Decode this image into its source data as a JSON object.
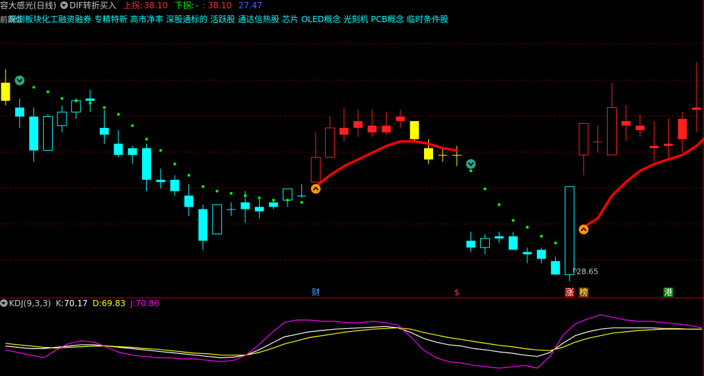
{
  "header": {
    "stock_name": "容大感光(日线)",
    "indicator": "DIF转折买入",
    "up_label": "上拐:",
    "up_value": "38.10",
    "down_label": "下拐:",
    "down_dash": "-",
    "down_value": ": 38.10",
    "extra_value": "27.47"
  },
  "concepts": "深圳板块化工融资融券 专精特新 高市净率 深股通标的 活跃股 通达信热股 芯片 OLED概念 光刻机 PCB概念 临时条件股",
  "overlap_text": "前期低",
  "kdj_header": {
    "name": "KDJ(9,3,3)",
    "k_label": "K:",
    "k_value": "70.17",
    "d_label": "D:",
    "d_value": "69.83",
    "j_label": "J:",
    "j_value": "70.86"
  },
  "markers": [
    {
      "text": "财",
      "color": "#4da6ff",
      "bar": 22
    },
    {
      "text": "$",
      "color": "#ff3333",
      "bar": 32
    },
    {
      "text": "涨",
      "color": "#ffffff",
      "bg": "#aa0000",
      "bar": 40
    },
    {
      "text": "榜",
      "color": "#ffff66",
      "bg": "#7a3a00",
      "bar": 41
    },
    {
      "text": "港",
      "color": "#ffffff",
      "bg": "#0a7a00",
      "bar": 47
    }
  ],
  "low_label": "28.65",
  "colors": {
    "up": "#ff2020",
    "down": "#00ffff",
    "special": "#ffff00",
    "sar": "#00ff00",
    "dif": "#ff0000",
    "k": "#ffffff",
    "d": "#ffff00",
    "j": "#ff00ff",
    "grid": "#800000"
  },
  "chart_data": [
    {
      "type": "candlestick",
      "title": "容大感光(日线)",
      "ylim": [
        27.5,
        39.5
      ],
      "candles": [
        {
          "o": 37.0,
          "h": 37.6,
          "l": 36.0,
          "c": 36.2,
          "color": "yellow"
        },
        {
          "o": 35.9,
          "h": 36.3,
          "l": 35.0,
          "c": 35.5,
          "color": "cyan"
        },
        {
          "o": 35.5,
          "h": 35.9,
          "l": 33.5,
          "c": 34.0,
          "color": "cyan"
        },
        {
          "o": 34.0,
          "h": 35.6,
          "l": 34.0,
          "c": 35.5,
          "color": "cyan"
        },
        {
          "o": 35.1,
          "h": 36.0,
          "l": 34.8,
          "c": 35.7,
          "color": "cyan"
        },
        {
          "o": 35.7,
          "h": 36.3,
          "l": 35.4,
          "c": 36.2,
          "color": "cyan"
        },
        {
          "o": 36.3,
          "h": 36.7,
          "l": 35.7,
          "c": 36.2,
          "color": "cyan"
        },
        {
          "o": 35.0,
          "h": 35.8,
          "l": 34.3,
          "c": 34.7,
          "color": "cyan"
        },
        {
          "o": 34.3,
          "h": 34.9,
          "l": 33.7,
          "c": 33.8,
          "color": "cyan"
        },
        {
          "o": 34.1,
          "h": 34.2,
          "l": 33.4,
          "c": 33.8,
          "color": "cyan"
        },
        {
          "o": 34.1,
          "h": 34.3,
          "l": 32.2,
          "c": 32.7,
          "color": "cyan"
        },
        {
          "o": 32.7,
          "h": 33.2,
          "l": 32.3,
          "c": 32.6,
          "color": "cyan"
        },
        {
          "o": 32.7,
          "h": 32.9,
          "l": 32.0,
          "c": 32.2,
          "color": "cyan"
        },
        {
          "o": 32.0,
          "h": 32.5,
          "l": 31.1,
          "c": 31.5,
          "color": "cyan"
        },
        {
          "o": 31.4,
          "h": 31.6,
          "l": 29.6,
          "c": 30.0,
          "color": "cyan"
        },
        {
          "o": 30.3,
          "h": 31.6,
          "l": 30.3,
          "c": 31.6,
          "color": "cyan"
        },
        {
          "o": 31.4,
          "h": 31.7,
          "l": 31.1,
          "c": 31.4,
          "color": "cyan"
        },
        {
          "o": 31.4,
          "h": 32.2,
          "l": 30.8,
          "c": 31.7,
          "color": "cyan"
        },
        {
          "o": 31.3,
          "h": 31.9,
          "l": 31.0,
          "c": 31.5,
          "color": "cyan"
        },
        {
          "o": 31.5,
          "h": 31.8,
          "l": 31.4,
          "c": 31.7,
          "color": "cyan"
        },
        {
          "o": 31.8,
          "h": 32.2,
          "l": 31.5,
          "c": 32.3,
          "color": "cyan"
        },
        {
          "o": 32.0,
          "h": 32.5,
          "l": 31.9,
          "c": 32.0,
          "color": "cyan"
        },
        {
          "o": 32.6,
          "h": 34.8,
          "l": 32.6,
          "c": 33.7,
          "color": "red"
        },
        {
          "o": 33.7,
          "h": 35.5,
          "l": 33.7,
          "c": 35.0,
          "color": "red"
        },
        {
          "o": 34.7,
          "h": 35.9,
          "l": 34.4,
          "c": 35.0,
          "color": "red"
        },
        {
          "o": 35.0,
          "h": 35.8,
          "l": 34.6,
          "c": 35.3,
          "color": "red"
        },
        {
          "o": 35.1,
          "h": 35.8,
          "l": 34.6,
          "c": 34.8,
          "color": "red"
        },
        {
          "o": 34.8,
          "h": 35.7,
          "l": 34.7,
          "c": 35.1,
          "color": "red"
        },
        {
          "o": 35.3,
          "h": 35.8,
          "l": 35.0,
          "c": 35.5,
          "color": "red"
        },
        {
          "o": 35.3,
          "h": 35.3,
          "l": 34.4,
          "c": 34.5,
          "color": "yellow"
        },
        {
          "o": 34.1,
          "h": 34.5,
          "l": 33.4,
          "c": 33.6,
          "color": "yellow"
        },
        {
          "o": 33.8,
          "h": 34.1,
          "l": 33.5,
          "c": 33.8,
          "color": "yellow"
        },
        {
          "o": 33.8,
          "h": 34.2,
          "l": 33.3,
          "c": 33.8,
          "color": "yellow"
        },
        {
          "o": 30.0,
          "h": 30.4,
          "l": 29.5,
          "c": 29.7,
          "color": "cyan"
        },
        {
          "o": 29.7,
          "h": 30.3,
          "l": 29.4,
          "c": 30.1,
          "color": "cyan"
        },
        {
          "o": 30.1,
          "h": 30.4,
          "l": 29.9,
          "c": 30.2,
          "color": "cyan"
        },
        {
          "o": 30.2,
          "h": 30.4,
          "l": 29.6,
          "c": 29.6,
          "color": "cyan"
        },
        {
          "o": 29.5,
          "h": 29.7,
          "l": 29.0,
          "c": 29.4,
          "color": "cyan"
        },
        {
          "o": 29.6,
          "h": 29.7,
          "l": 29.0,
          "c": 29.2,
          "color": "cyan"
        },
        {
          "o": 29.1,
          "h": 29.3,
          "l": 28.5,
          "c": 28.5,
          "color": "cyan"
        },
        {
          "o": 28.5,
          "h": 32.4,
          "l": 28.2,
          "c": 32.4,
          "color": "cyan"
        },
        {
          "o": 33.8,
          "h": 35.0,
          "l": 32.9,
          "c": 35.2,
          "color": "red"
        },
        {
          "o": 34.4,
          "h": 35.1,
          "l": 33.9,
          "c": 34.4,
          "color": "red"
        },
        {
          "o": 33.8,
          "h": 37.0,
          "l": 33.8,
          "c": 35.9,
          "color": "red"
        },
        {
          "o": 35.1,
          "h": 36.0,
          "l": 34.4,
          "c": 35.3,
          "color": "red"
        },
        {
          "o": 34.9,
          "h": 35.6,
          "l": 34.6,
          "c": 35.1,
          "color": "red"
        },
        {
          "o": 34.1,
          "h": 35.3,
          "l": 33.5,
          "c": 34.2,
          "color": "red"
        },
        {
          "o": 34.3,
          "h": 35.4,
          "l": 33.6,
          "c": 34.2,
          "color": "red"
        },
        {
          "o": 34.5,
          "h": 35.7,
          "l": 33.9,
          "c": 35.4,
          "color": "red"
        },
        {
          "o": 35.8,
          "h": 37.9,
          "l": 34.8,
          "c": 35.9,
          "color": "red"
        }
      ],
      "sar": [
        [
          1,
          37.1
        ],
        [
          2,
          36.8
        ],
        [
          3,
          36.6
        ],
        [
          4,
          36.3
        ],
        [
          5,
          36.2
        ],
        [
          6,
          36.1
        ],
        [
          7,
          35.9
        ],
        [
          8,
          35.6
        ],
        [
          9,
          35.1
        ],
        [
          10,
          34.5
        ],
        [
          11,
          34.0
        ],
        [
          12,
          33.4
        ],
        [
          13,
          32.9
        ],
        [
          14,
          32.4
        ],
        [
          15,
          32.2
        ],
        [
          16,
          32.1
        ],
        [
          17,
          32.0
        ],
        [
          18,
          31.9
        ],
        [
          19,
          31.8
        ],
        [
          20,
          31.8
        ],
        [
          21,
          31.7
        ],
        [
          33,
          33.1
        ],
        [
          34,
          32.3
        ],
        [
          35,
          31.6
        ],
        [
          36,
          30.9
        ],
        [
          37,
          30.6
        ],
        [
          38,
          30.2
        ],
        [
          39,
          29.9
        ]
      ],
      "dif": [
        [
          22,
          32.4
        ],
        [
          23,
          32.9
        ],
        [
          24,
          33.3
        ],
        [
          25,
          33.6
        ],
        [
          26,
          33.9
        ],
        [
          27,
          34.2
        ],
        [
          28,
          34.4
        ],
        [
          29,
          34.4
        ],
        [
          30,
          34.3
        ],
        [
          31,
          34.1
        ],
        [
          32,
          34.0
        ],
        [
          41,
          30.6
        ],
        [
          42,
          31.0
        ],
        [
          43,
          32.0
        ],
        [
          44,
          32.6
        ],
        [
          45,
          33.1
        ],
        [
          46,
          33.4
        ],
        [
          47,
          33.6
        ],
        [
          48,
          33.8
        ],
        [
          49,
          34.2
        ],
        [
          50,
          34.8
        ]
      ],
      "low_marker": {
        "x": 40,
        "value": 28.65
      }
    },
    {
      "type": "line",
      "title": "KDJ(9,3,3)",
      "ylim": [
        0,
        100
      ],
      "series": [
        {
          "name": "K",
          "values": [
            44,
            42,
            40,
            40,
            42,
            44,
            46,
            46,
            44,
            42,
            40,
            38,
            36,
            34,
            32,
            30,
            28,
            26,
            27,
            30,
            38,
            48,
            58,
            62,
            66,
            68,
            70,
            71,
            72,
            73,
            74,
            72,
            65,
            56,
            50,
            46,
            44,
            40,
            38,
            35,
            33,
            30,
            28,
            34,
            48,
            60,
            66,
            70,
            72,
            72,
            72,
            72,
            71,
            71,
            70,
            70
          ]
        },
        {
          "name": "D",
          "values": [
            48,
            46,
            44,
            42,
            41,
            42,
            43,
            44,
            44,
            43,
            42,
            40,
            39,
            37,
            35,
            33,
            32,
            30,
            30,
            30,
            34,
            40,
            47,
            52,
            57,
            60,
            63,
            66,
            68,
            70,
            71,
            72,
            70,
            65,
            61,
            57,
            54,
            51,
            48,
            45,
            43,
            40,
            38,
            37,
            42,
            50,
            56,
            60,
            64,
            66,
            68,
            69,
            70,
            70,
            70,
            70
          ]
        },
        {
          "name": "J",
          "values": [
            38,
            34,
            30,
            26,
            38,
            48,
            52,
            50,
            42,
            34,
            30,
            28,
            26,
            26,
            24,
            24,
            22,
            20,
            22,
            30,
            46,
            64,
            80,
            84,
            84,
            82,
            82,
            80,
            80,
            82,
            80,
            76,
            58,
            38,
            26,
            20,
            18,
            14,
            12,
            10,
            12,
            14,
            10,
            28,
            60,
            78,
            86,
            92,
            88,
            84,
            82,
            82,
            80,
            78,
            76,
            72
          ]
        }
      ]
    }
  ]
}
